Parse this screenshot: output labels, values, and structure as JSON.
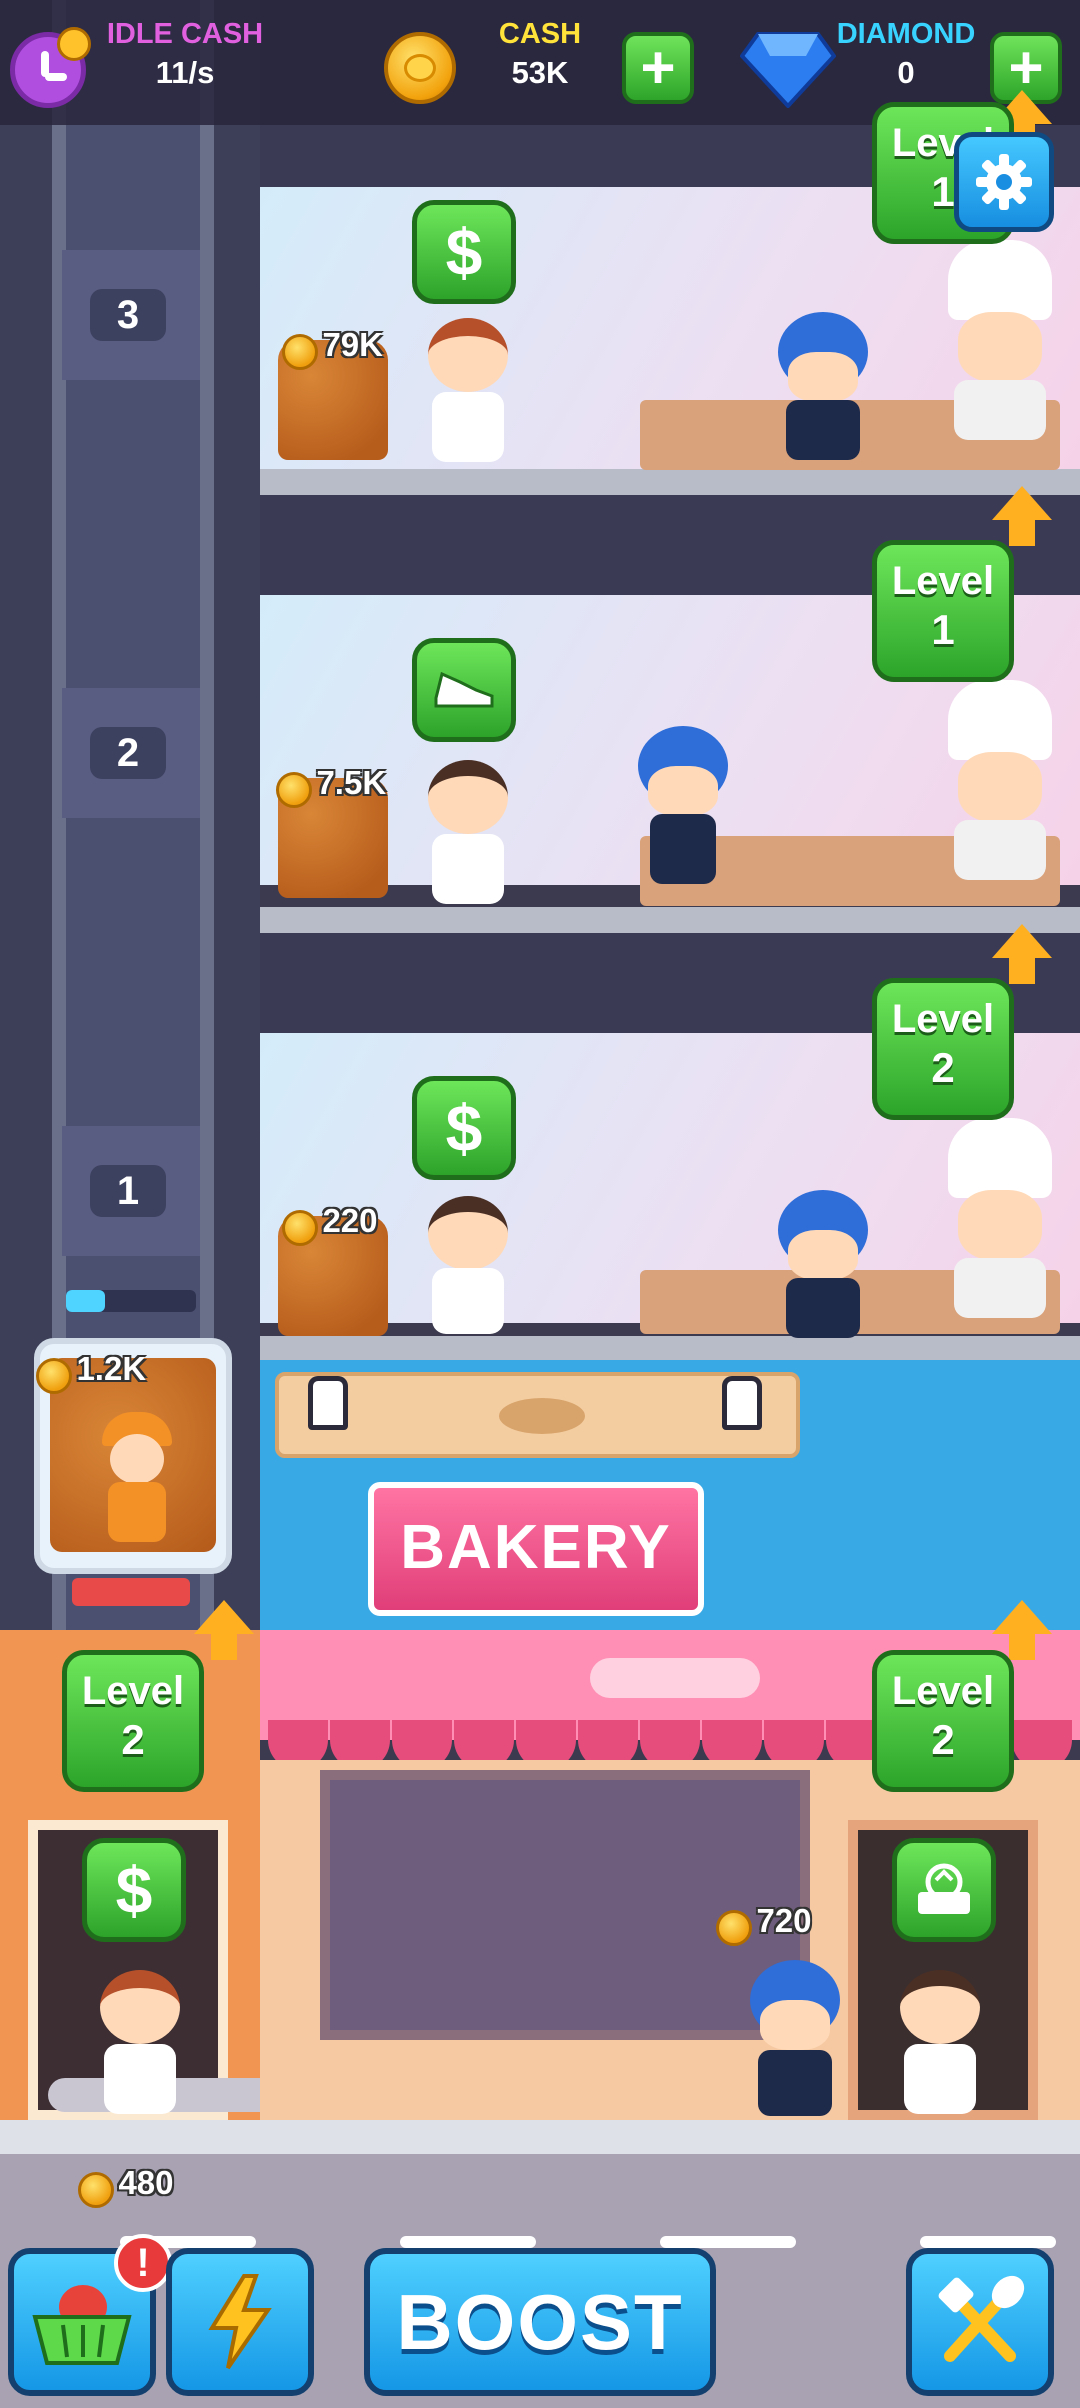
{
  "hud": {
    "idle_cash": {
      "label": "IDLE CASH",
      "value": "11/s"
    },
    "cash": {
      "label": "CASH",
      "value": "53K"
    },
    "diamond": {
      "label": "DIAMOND",
      "value": "0"
    },
    "plus": "+"
  },
  "elevator": {
    "floor_tags": [
      "3",
      "2",
      "1"
    ],
    "cart_amount": "1.2K",
    "level_label": "Level",
    "level_value": "2",
    "progress": 0.3
  },
  "floors": [
    {
      "number": "3",
      "pile_amount": "79K",
      "level_label": "Level",
      "level_value": "1",
      "manager_icon": "dollar-icon"
    },
    {
      "number": "2",
      "pile_amount": "7.5K",
      "level_label": "Level",
      "level_value": "1",
      "manager_icon": "shoe-icon"
    },
    {
      "number": "1",
      "pile_amount": "220",
      "level_label": "Level",
      "level_value": "2",
      "manager_icon": "dollar-icon"
    }
  ],
  "bakery": {
    "sign": "BAKERY",
    "shop_amount": "720",
    "level_label": "Level",
    "level_value": "2"
  },
  "street": {
    "amount": "480"
  },
  "bottom_bar": {
    "boost": "BOOST",
    "alert": "!"
  },
  "colors": {
    "idle_cash_label": "#e060e0",
    "cash_label": "#ffe23a",
    "diamond_label": "#38d4ff"
  }
}
